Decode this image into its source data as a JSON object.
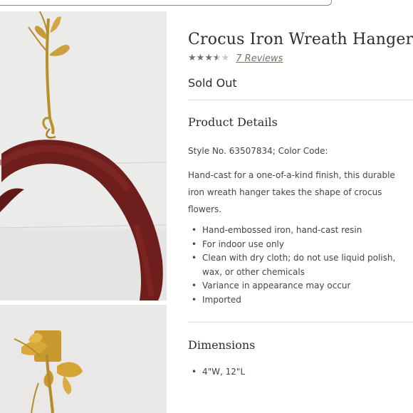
{
  "product": {
    "title": "Crocus Iron Wreath Hanger",
    "rating_stars": 3.5,
    "reviews_link": "7 Reviews",
    "availability": "Sold Out",
    "accent_color": "#6b7560"
  },
  "details": {
    "heading": "Product Details",
    "style_line": "Style No. 63507834; Color Code:",
    "description": "Hand-cast for a one-of-a-kind finish, this durable iron wreath hanger takes the shape of crocus flowers.",
    "bullets": [
      "Hand-embossed iron, hand-cast resin",
      "For indoor use only",
      "Clean with dry cloth; do not use liquid polish, wax, or other chemicals",
      "Variance in appearance may occur",
      "Imported"
    ]
  },
  "dimensions": {
    "heading": "Dimensions",
    "bullets": [
      "4\"W, 12\"L"
    ]
  },
  "gallery": {
    "image_1_icon": "wreath-on-hanger-photo",
    "image_2_icon": "gold-crocus-hanger-photo"
  }
}
